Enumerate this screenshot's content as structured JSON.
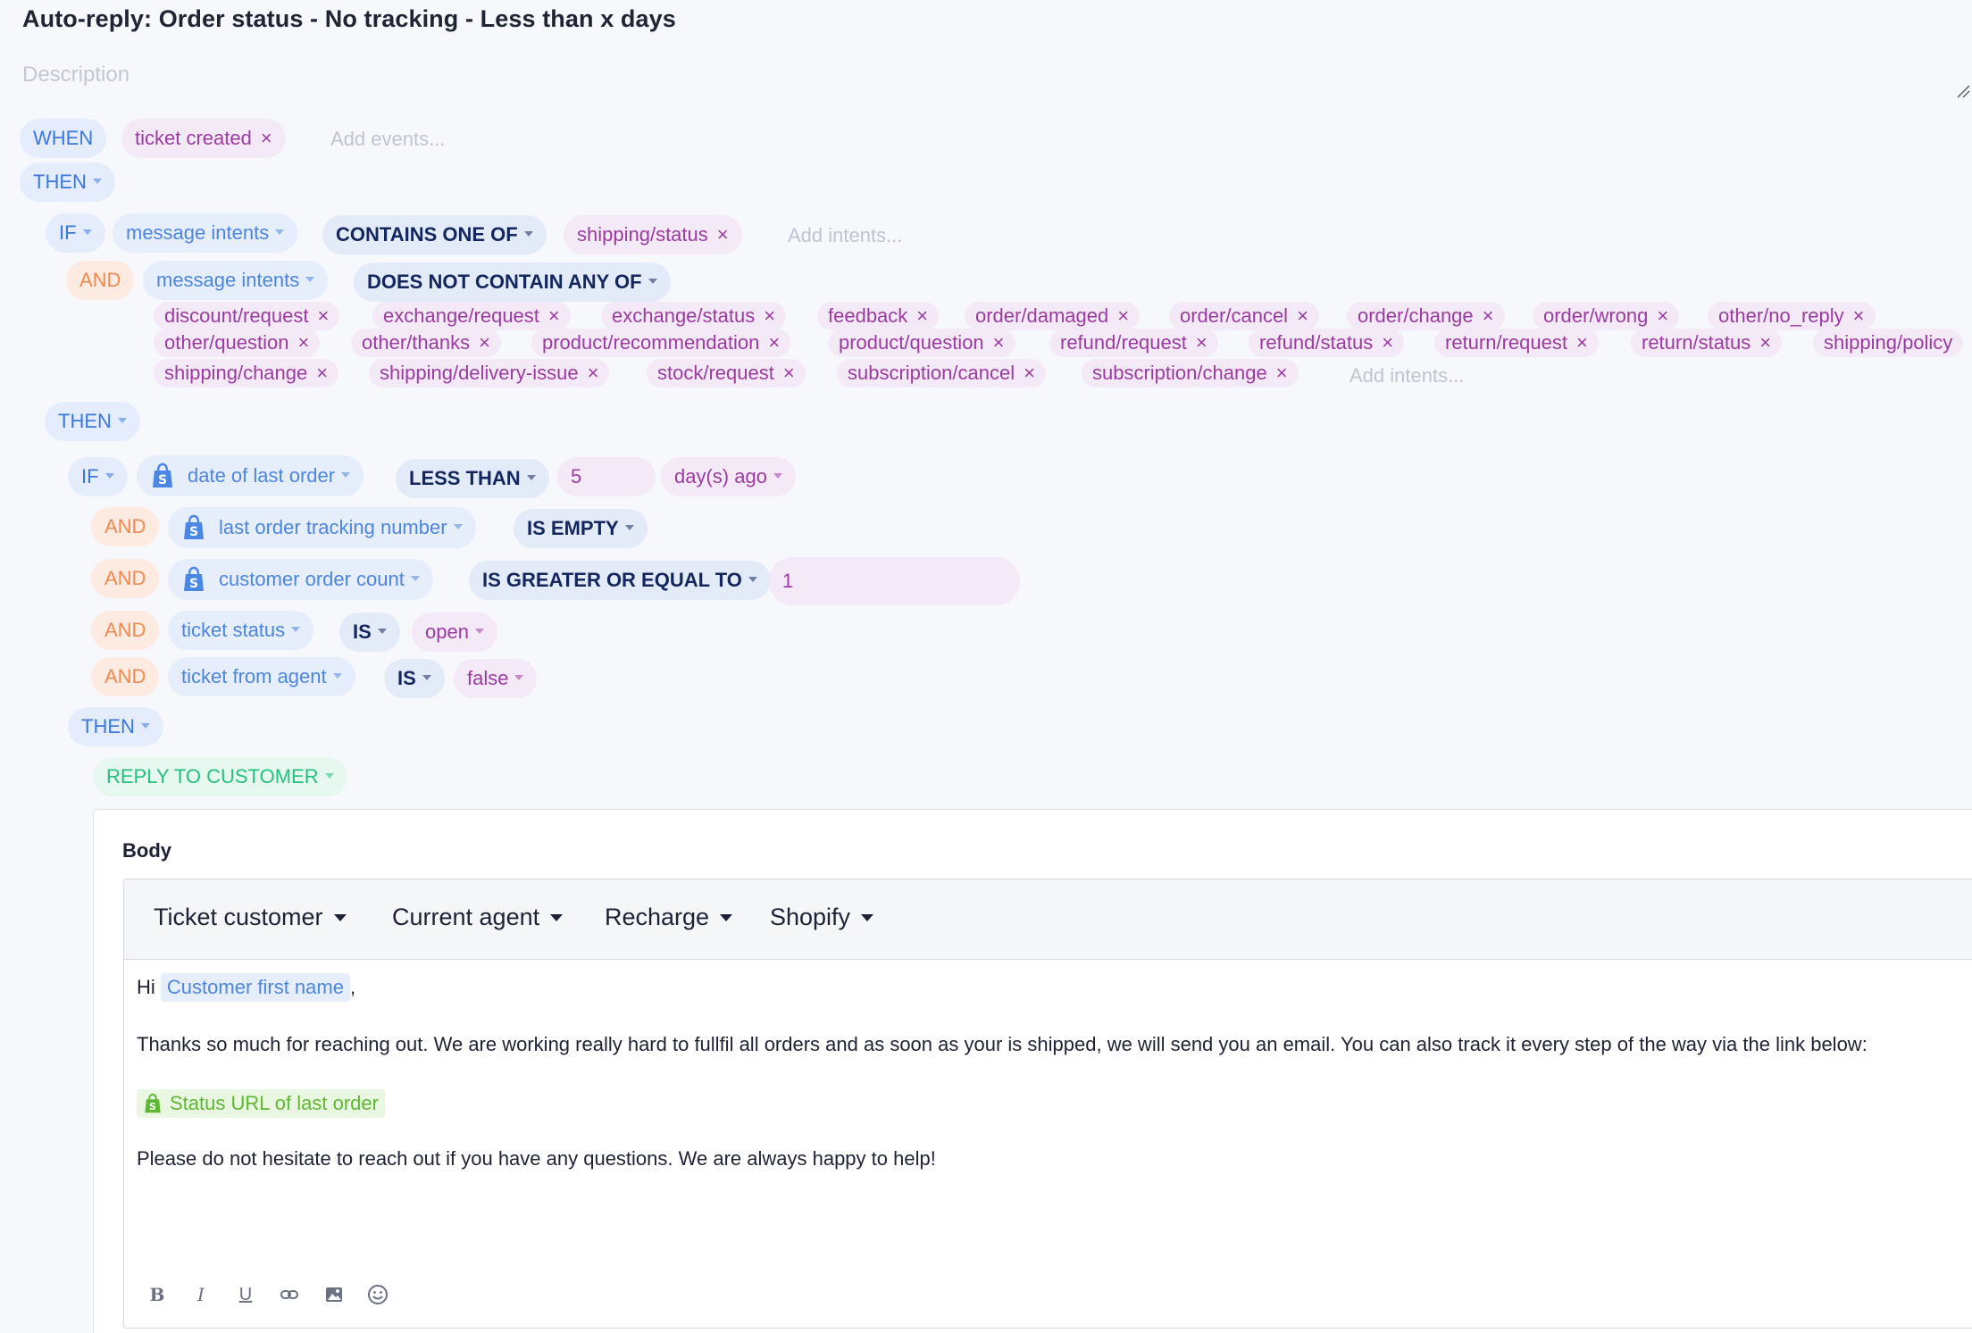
{
  "rule": {
    "title": "Auto-reply: Order status - No tracking - Less than x days",
    "description_placeholder": "Description"
  },
  "when": {
    "keyword": "WHEN",
    "events": [
      "ticket created"
    ],
    "add_placeholder": "Add events..."
  },
  "then1": {
    "keyword": "THEN"
  },
  "if1": {
    "keyword": "IF",
    "field": "message intents",
    "operator": "CONTAINS ONE OF",
    "values": [
      "shipping/status"
    ],
    "add_placeholder": "Add intents..."
  },
  "and1": {
    "keyword": "AND",
    "field": "message intents",
    "operator": "DOES NOT CONTAIN ANY OF",
    "values": [
      "discount/request",
      "exchange/request",
      "exchange/status",
      "feedback",
      "order/damaged",
      "order/cancel",
      "order/change",
      "order/wrong",
      "other/no_reply",
      "other/question",
      "other/thanks",
      "product/recommendation",
      "product/question",
      "refund/request",
      "refund/status",
      "return/request",
      "return/status",
      "shipping/policy",
      "shipping/change",
      "shipping/delivery-issue",
      "stock/request",
      "subscription/cancel",
      "subscription/change"
    ],
    "add_placeholder": "Add intents..."
  },
  "then2": {
    "keyword": "THEN"
  },
  "if2": {
    "keyword": "IF",
    "field": "date of last order",
    "operator": "LESS THAN",
    "value": "5",
    "unit": "day(s) ago"
  },
  "conditions": [
    {
      "keyword": "AND",
      "field": "last order tracking number",
      "operator": "IS EMPTY"
    },
    {
      "keyword": "AND",
      "field": "customer order count",
      "operator": "IS GREATER OR EQUAL TO",
      "value": "1"
    },
    {
      "keyword": "AND",
      "field": "ticket status",
      "operator": "IS",
      "value": "open"
    },
    {
      "keyword": "AND",
      "field": "ticket from agent",
      "operator": "IS",
      "value": "false"
    }
  ],
  "then3": {
    "keyword": "THEN"
  },
  "action": {
    "label": "REPLY TO CUSTOMER",
    "body_label": "Body",
    "toolbar": [
      "Ticket customer",
      "Current agent",
      "Recharge",
      "Shopify"
    ],
    "greeting": "Hi",
    "greeting_var": "Customer first name",
    "greeting_end": ",",
    "paragraph1": "Thanks so much for reaching out. We are working really hard to fullfil all orders and as soon as your is shipped, we will send you an email. You can also track it every step of the way via the link below:",
    "link_var": "Status URL of last order",
    "paragraph2": "Please do not hesitate to reach out if you have any questions. We are always happy to help!",
    "format_buttons": [
      "bold-icon",
      "italic-icon",
      "underline-icon",
      "link-icon",
      "image-icon",
      "emoji-icon"
    ]
  },
  "colors": {
    "keyword_blue": "#3a78e0",
    "keyword_orange": "#ef8a52",
    "action_green": "#24c07e",
    "operator_navy": "#13265e",
    "value_purple": "#9b3ba2"
  }
}
